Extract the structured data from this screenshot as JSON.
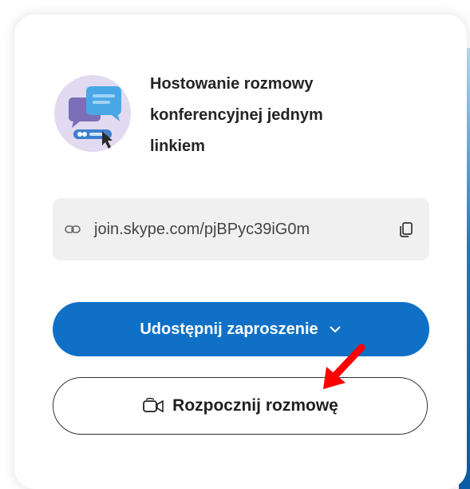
{
  "dialog": {
    "title": "Hostowanie rozmowy\nkonferencyjnej jednym\nlinkiem",
    "illustration_icon": "chat-link-illustration-icon"
  },
  "link": {
    "url": "join.skype.com/pjBPyc39iG0m",
    "icon": "link-icon",
    "copy_icon": "copy-icon"
  },
  "actions": {
    "share_label": "Udostępnij zaproszenie",
    "share_icon": "chevron-down-icon",
    "start_label": "Rozpocznij rozmowę",
    "start_icon": "video-camera-icon"
  },
  "annotation": {
    "arrow_icon": "red-arrow-icon",
    "arrow_color": "#ff0000"
  },
  "colors": {
    "primary_button": "#0f70c6",
    "link_box_bg": "#f0f0f0",
    "title_text": "#242424"
  }
}
